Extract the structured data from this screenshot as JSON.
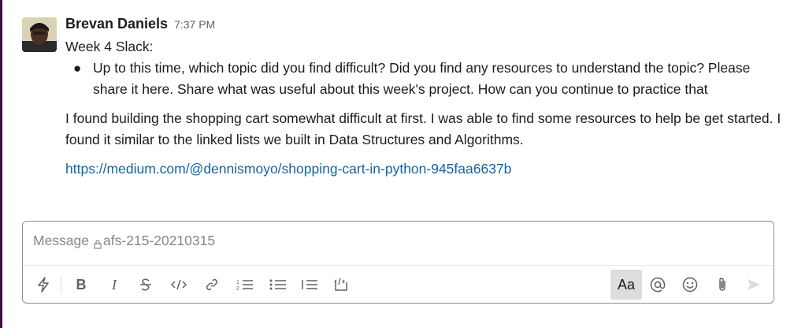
{
  "message": {
    "author": "Brevan Daniels",
    "time": "7:37 PM",
    "title": "Week 4 Slack:",
    "bullet_text": "Up to this time, which topic did you find difficult? Did you find any resources to understand the topic? Please share it here. Share what was useful about this week's project. How can you continue to practice that",
    "reply": "I found building the shopping cart somewhat difficult at first. I was able to find some resources to help be get started. I found it similar to the linked lists we built in Data Structures and Algorithms.",
    "link": "https://medium.com/@dennismoyo/shopping-cart-in-python-945faa6637b"
  },
  "composer": {
    "placeholder_prefix": "Message",
    "channel": "afs-215-20210315",
    "format_label": "Aa"
  },
  "colors": {
    "link": "#1264a3",
    "sidebar": "#3f0e40",
    "text": "#1d1c1d"
  },
  "icons": [
    "shortcuts-icon",
    "bold-icon",
    "italic-icon",
    "strikethrough-icon",
    "code-icon",
    "link-icon",
    "ordered-list-icon",
    "bulleted-list-icon",
    "blockquote-icon",
    "code-block-icon",
    "format-icon",
    "mention-icon",
    "emoji-icon",
    "attachment-icon",
    "send-icon"
  ]
}
